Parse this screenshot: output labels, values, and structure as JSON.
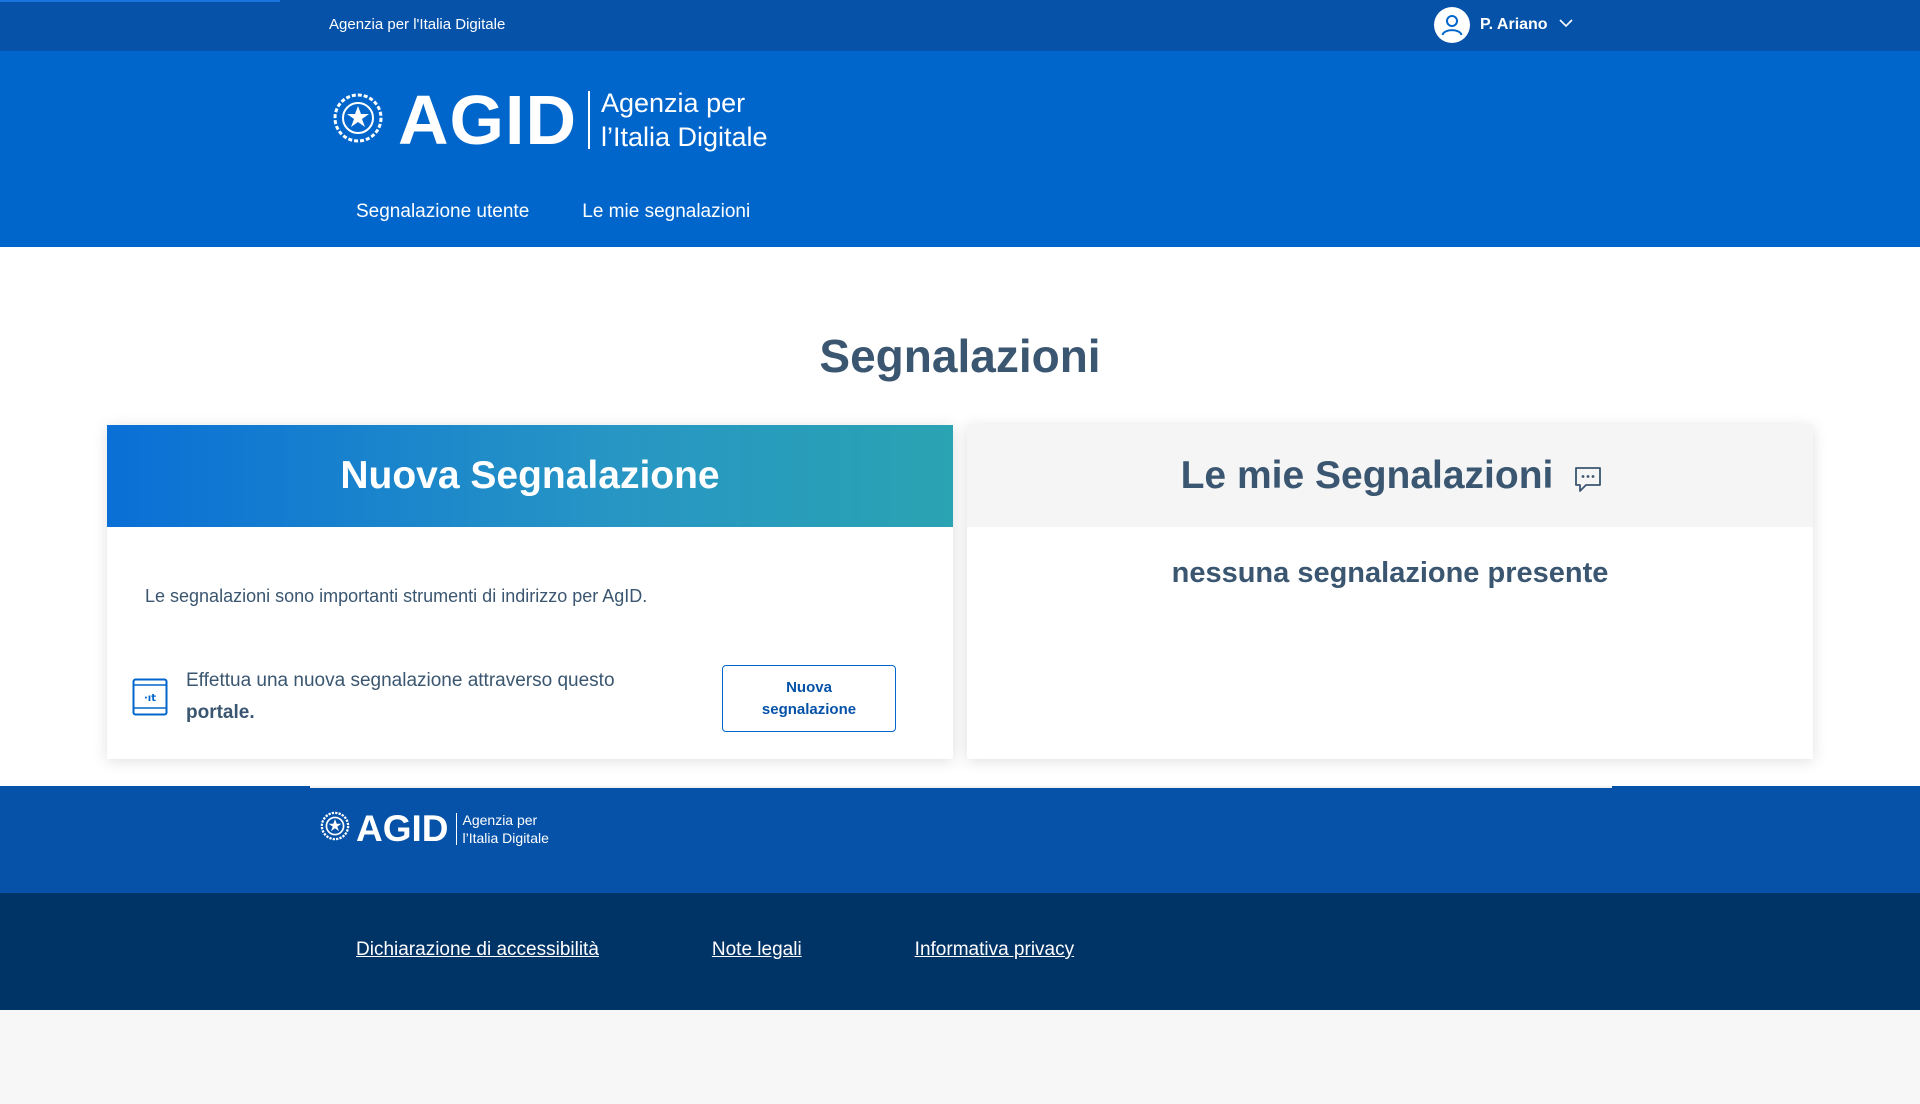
{
  "slim_header": {
    "org_name": "Agenzia per l'Italia Digitale",
    "user_name": "P. Ariano"
  },
  "header": {
    "logo_word": "AGID",
    "logo_tagline_1": "Agenzia per",
    "logo_tagline_2": "l’Italia Digitale",
    "nav": [
      "Segnalazione utente",
      "Le mie segnalazioni"
    ]
  },
  "main": {
    "title": "Segnalazioni",
    "new_card": {
      "title": "Nuova Segnalazione",
      "description": "Le segnalazioni sono importanti strumenti di indirizzo per AgID.",
      "row_text": "Effettua una nuova segnalazione attraverso questo",
      "row_bold": "portale.",
      "button_line1": "Nuova",
      "button_line2": "segnalazione"
    },
    "my_card": {
      "title": "Le mie Segnalazioni",
      "empty_text": "nessuna segnalazione presente"
    }
  },
  "footer": {
    "logo_word": "AGID",
    "logo_tagline_1": "Agenzia per",
    "logo_tagline_2": "l’Italia Digitale",
    "links": [
      "Dichiarazione di accessibilità",
      "Note legali",
      "Informativa privacy"
    ]
  },
  "colors": {
    "primary": "#0066cc",
    "dark_blue": "#0552a8",
    "footer_dark": "#003366",
    "text": "#3a5670"
  },
  "icons": {
    "user": "user-avatar-icon",
    "dropdown": "chevron-down-icon",
    "emblem": "emblem-icon",
    "chat": "chat-bubble-icon",
    "device": "tablet-it-icon"
  }
}
